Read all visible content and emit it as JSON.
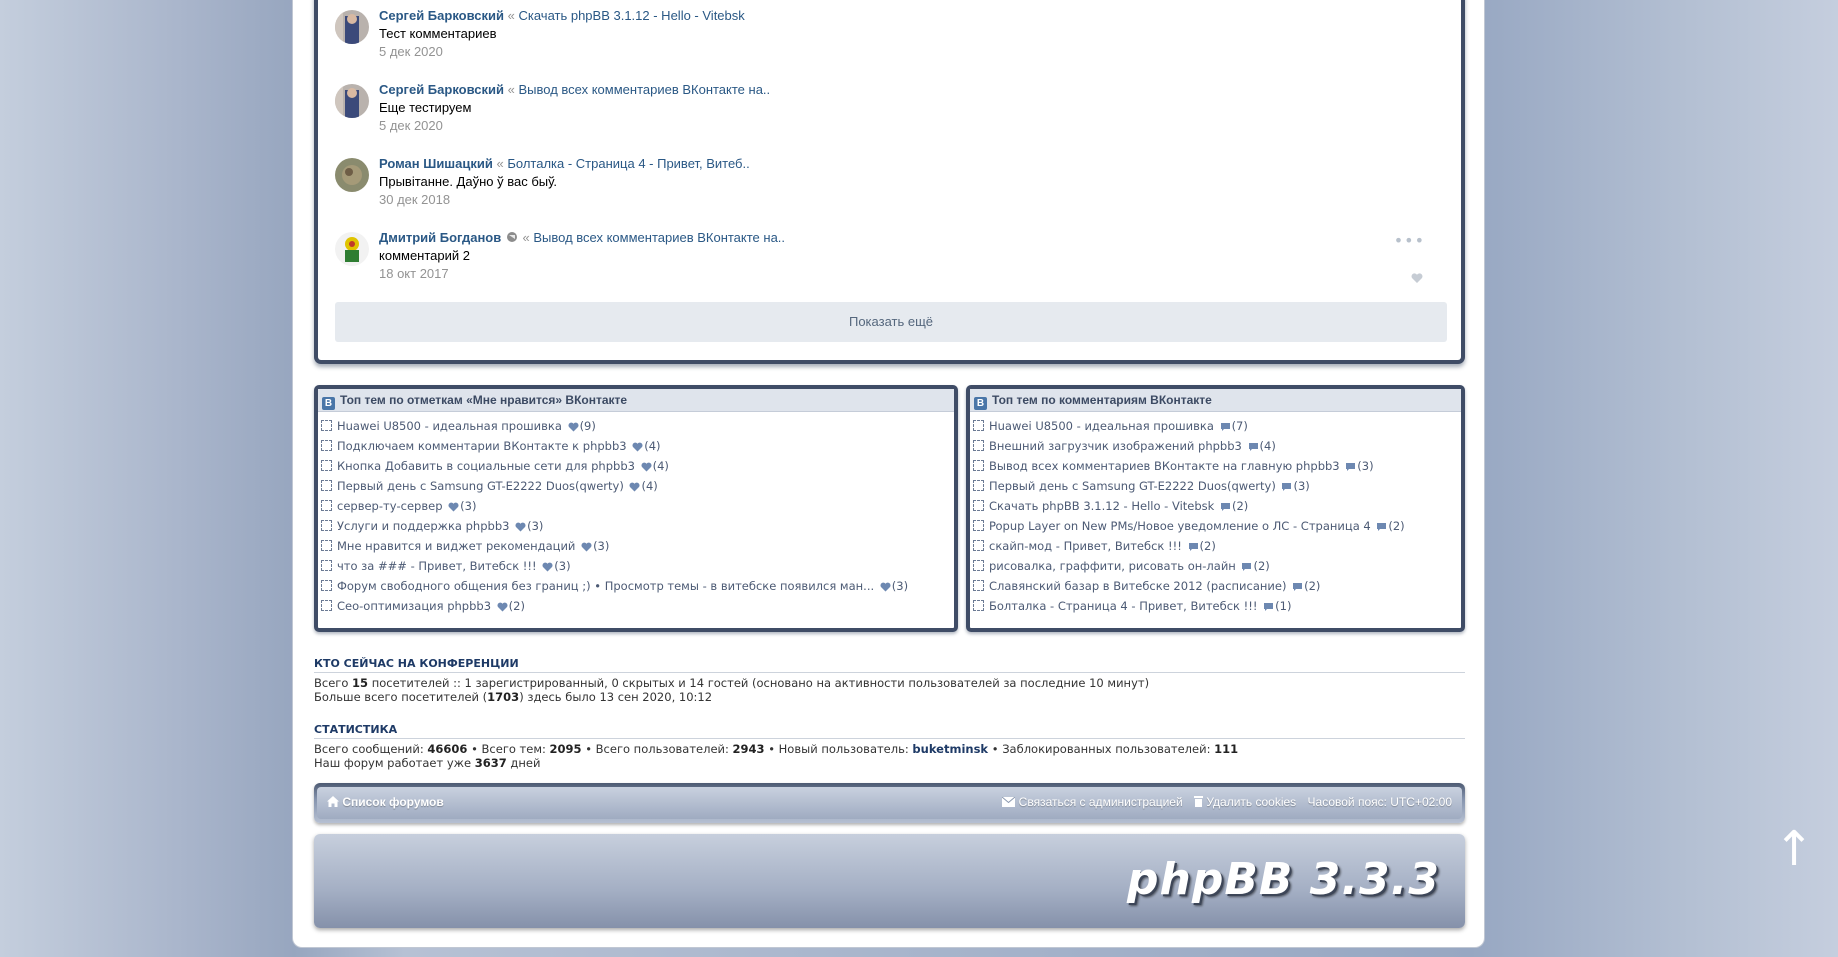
{
  "comments": [
    {
      "author": "Сергей Барковский",
      "sep": "«",
      "topic": "Скачать phpBB 3.1.12 - Hello - Vitebsk",
      "text": "Тест комментариев",
      "date": "5 дек 2020"
    },
    {
      "author": "Сергей Барковский",
      "sep": "«",
      "topic": "Вывод всех комментариев ВКонтакте на..",
      "text": "Еще тестируем",
      "date": "5 дек 2020"
    },
    {
      "author": "Роман Шишацкий",
      "sep": "«",
      "topic": "Болталка - Страница 4 - Привет, Витеб..",
      "text": "Прывітанне. Даўно ў вас быў.",
      "date": "30 дек 2018"
    },
    {
      "author": "Дмитрий Богданов",
      "sep": "«",
      "topic": "Вывод всех комментариев ВКонтакте на..",
      "text": "комментарий 2",
      "date": "18 окт 2017"
    }
  ],
  "show_more": "Показать ещё",
  "likes_box": {
    "badge": "B",
    "title": "Топ тем по отметкам «Мне нравится» ВКонтакте",
    "items": [
      {
        "label": "Huawei U8500 - идеальная прошивка",
        "count": "(9)"
      },
      {
        "label": "Подключаем комментарии ВКонтакте к phpbb3",
        "count": "(4)"
      },
      {
        "label": "Кнопка Добавить в социальные сети для phpbb3",
        "count": "(4)"
      },
      {
        "label": "Первый день с Samsung GT-E2222 Duos(qwerty)",
        "count": "(4)"
      },
      {
        "label": "сервер-ту-сервер",
        "count": "(3)"
      },
      {
        "label": "Услуги и поддержка phpbb3",
        "count": "(3)"
      },
      {
        "label": "Мне нравится и виджет рекомендаций",
        "count": "(3)"
      },
      {
        "label": "что за ### - Привет, Витебск !!!",
        "count": "(3)"
      },
      {
        "label": "Форум свободного общения без границ ;) • Просмотр темы - в витебске появился ман...",
        "count": "(3)"
      },
      {
        "label": "Сео-оптимизация phpbb3",
        "count": "(2)"
      }
    ]
  },
  "comments_box": {
    "badge": "B",
    "title": "Топ тем по комментариям ВКонтакте",
    "items": [
      {
        "label": "Huawei U8500 - идеальная прошивка",
        "count": "(7)"
      },
      {
        "label": "Внешний загрузчик изображений phpbb3",
        "count": "(4)"
      },
      {
        "label": "Вывод всех комментариев ВКонтакте на главную phpbb3",
        "count": "(3)"
      },
      {
        "label": "Первый день с Samsung GT-E2222 Duos(qwerty)",
        "count": "(3)"
      },
      {
        "label": "Скачать phpBB 3.1.12 - Hello - Vitebsk",
        "count": "(2)"
      },
      {
        "label": "Popup Layer on New PMs/Новое уведомление о ЛС - Страница 4",
        "count": "(2)"
      },
      {
        "label": "скайп-мод - Привет, Витебск !!!",
        "count": "(2)"
      },
      {
        "label": "рисовалка, граффити, рисовать он-лайн",
        "count": "(2)"
      },
      {
        "label": "Славянский базар в Витебске 2012 (расписание)",
        "count": "(2)"
      },
      {
        "label": "Болталка - Страница 4 - Привет, Витебск !!!",
        "count": "(1)"
      }
    ]
  },
  "online": {
    "title": "КТО СЕЙЧАС НА КОНФЕРЕНЦИИ",
    "line1_pre": "Всего ",
    "line1_num": "15",
    "line1_post": " посетителей :: 1 зарегистрированный, 0 скрытых и 14 гостей (основано на активности пользователей за последние 10 минут)",
    "line2_pre": "Больше всего посетителей (",
    "line2_num": "1703",
    "line2_post": ") здесь было 13 сен 2020, 10:12"
  },
  "stats": {
    "title": "СТАТИСТИКА",
    "posts_label": "Всего сообщений: ",
    "posts": "46606",
    "topics_label": " • Всего тем: ",
    "topics": "2095",
    "users_label": " • Всего пользователей: ",
    "users": "2943",
    "new_label": " • Новый пользователь: ",
    "new_user": "buketminsk",
    "banned_label": " • Заблокированных пользователей: ",
    "banned": "111",
    "days_pre": "Наш форум работает уже ",
    "days": "3637",
    "days_post": " дней"
  },
  "footer": {
    "home": "Список форумов",
    "contact": "Связаться с администрацией",
    "cookies": "Удалить cookies",
    "timezone": "Часовой пояс: UTC+02:00"
  },
  "logo": "phpBB 3.3.3",
  "scroll_top": "↑",
  "colors": {
    "link": "#2a5885",
    "frame": "#3f4c66",
    "heart": "#6d88b1"
  }
}
